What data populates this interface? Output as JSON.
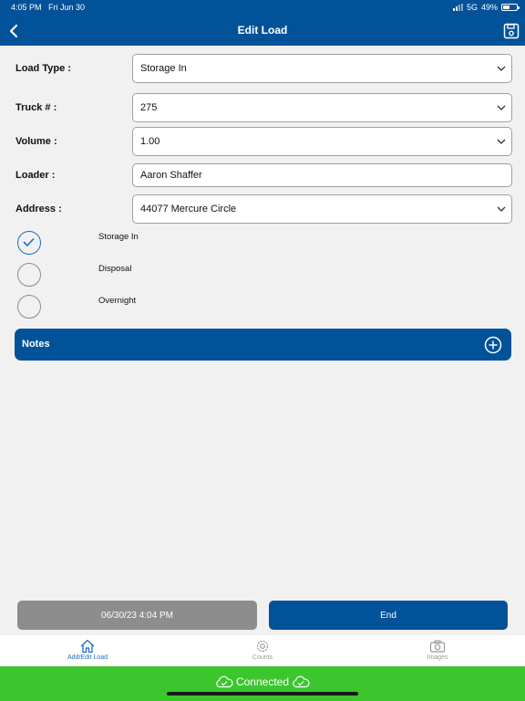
{
  "status_bar": {
    "time": "4:05 PM",
    "date": "Fri Jun 30",
    "network": "5G",
    "battery": "49%"
  },
  "header": {
    "title": "Edit Load"
  },
  "form": {
    "load_type": {
      "label": "Load Type :",
      "value": "Storage In"
    },
    "truck": {
      "label": "Truck # :",
      "value": "275"
    },
    "volume": {
      "label": "Volume :",
      "value": "1.00"
    },
    "loader": {
      "label": "Loader :",
      "value": "Aaron Shaffer"
    },
    "address": {
      "label": "Address :",
      "value": "44077 Mercure Circle"
    }
  },
  "options": [
    {
      "label": "Storage In",
      "checked": true
    },
    {
      "label": "Disposal",
      "checked": false
    },
    {
      "label": "Overnight",
      "checked": false
    }
  ],
  "notes": {
    "label": "Notes"
  },
  "actions": {
    "timestamp": "06/30/23 4:04 PM",
    "end": "End"
  },
  "tabs": [
    {
      "label": "Add/Edit Load",
      "icon": "home-icon",
      "active": true
    },
    {
      "label": "Counts",
      "icon": "gear-icon",
      "active": false
    },
    {
      "label": "Images",
      "icon": "camera-icon",
      "active": false
    }
  ],
  "connection": {
    "status": "Connected"
  },
  "colors": {
    "primary": "#02529a",
    "connected": "#3bc62d",
    "button_disabled": "#8d8d8d",
    "accent": "#1f6ec2"
  }
}
